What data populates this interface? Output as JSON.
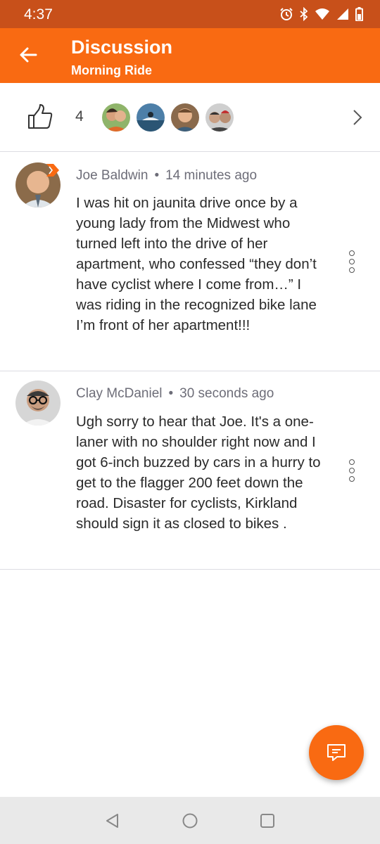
{
  "status_bar": {
    "time": "4:37"
  },
  "header": {
    "title": "Discussion",
    "subtitle": "Morning Ride"
  },
  "kudos": {
    "count": "4",
    "avatars": [
      "athlete-1",
      "athlete-2",
      "athlete-3",
      "athlete-4"
    ]
  },
  "comments": [
    {
      "author": "Joe Baldwin",
      "time": "14 minutes ago",
      "text": "I was hit on jaunita drive once by a young lady from the Midwest who turned left into the drive of her apartment, who confessed “they don’t have cyclist where I come from…” I was riding in the recognized bike lane I’m front of her apartment!!!"
    },
    {
      "author": "Clay McDaniel",
      "time": "30 seconds ago",
      "text": "Ugh sorry to hear that Joe. It's a one-laner with no shoulder right now and I got 6-inch buzzed by cars in a hurry to get to the flagger 200 feet down the road. Disaster for cyclists, Kirkland should sign it as closed to bikes ."
    }
  ],
  "colors": {
    "brand": "#f96a12",
    "status_bar": "#c8501a",
    "nav_bar": "#e9e9e9"
  },
  "icons": {
    "back": "arrow-left-icon",
    "kudos": "thumbs-up-icon",
    "more": "chevron-right-icon",
    "menu": "vertical-dots-icon",
    "compose": "comment-icon"
  }
}
